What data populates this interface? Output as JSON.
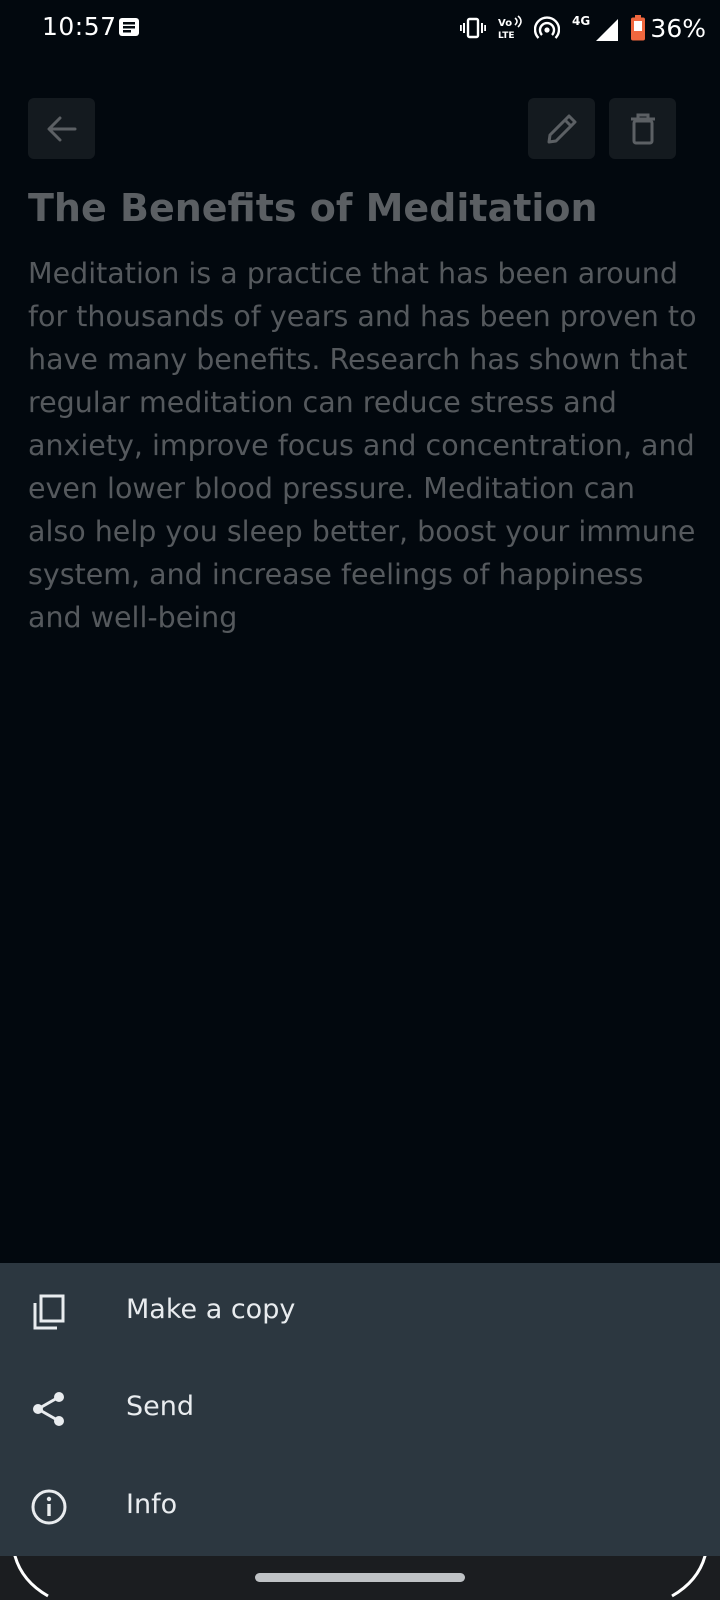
{
  "status_bar": {
    "time": "10:57",
    "network": "4G",
    "volte": "Vo LTE",
    "battery": "36%",
    "battery_color": "#f0673e",
    "icons": [
      "notification-icon",
      "vibrate-icon",
      "volte-icon",
      "hotspot-icon",
      "signal-icon",
      "battery-icon"
    ]
  },
  "toolbar": {
    "back_icon": "arrow-left-icon",
    "edit_icon": "pencil-icon",
    "delete_icon": "trash-icon"
  },
  "note": {
    "title": "The Benefits of Meditation",
    "body": "Meditation is a practice that has been around for thousands of years and has been proven to have many benefits. Research has shown that regular meditation can reduce stress and anxiety, improve focus and concentration, and even lower blood pressure. Meditation can also help you sleep better, boost your immune system, and increase feelings of happiness and well-being"
  },
  "menu": {
    "items": [
      {
        "label": "Make a copy",
        "icon": "copy-icon"
      },
      {
        "label": "Send",
        "icon": "share-icon"
      },
      {
        "label": "Info",
        "icon": "info-icon"
      }
    ]
  },
  "colors": {
    "background": "#02080e",
    "sheet": "#2c3740",
    "button": "#141a1f"
  }
}
